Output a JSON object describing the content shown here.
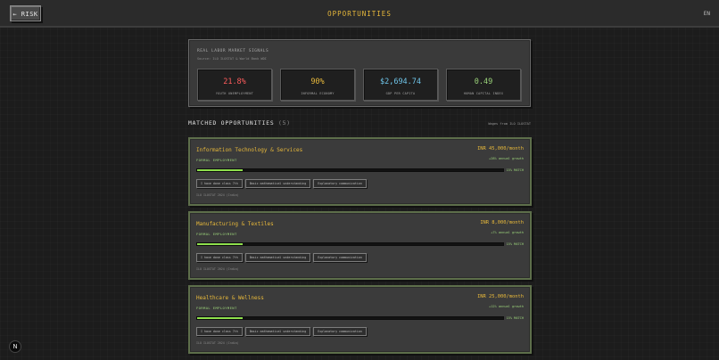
{
  "header": {
    "back_label": "← RISK",
    "title": "OPPORTUNITIES",
    "lang": "EN"
  },
  "signals": {
    "title": "REAL LABOR MARKET SIGNALS",
    "source": "Source: ILO ILOSTAT & World Bank WDI",
    "stats": [
      {
        "value": "21.8%",
        "label": "YOUTH UNEMPLOYMENT",
        "color": "#ff5c5c"
      },
      {
        "value": "90%",
        "label": "INFORMAL ECONOMY",
        "color": "#e8b93b"
      },
      {
        "value": "$2,694.74",
        "label": "GDP PER CAPITA",
        "color": "#6fc4e8"
      },
      {
        "value": "0.49",
        "label": "HUMAN CAPITAL INDEX",
        "color": "#9bd37a"
      }
    ]
  },
  "matched": {
    "title": "MATCHED OPPORTUNITIES",
    "count": "(5)",
    "source": "Wages from ILO ILOSTAT"
  },
  "cards": [
    {
      "title": "Information Technology & Services",
      "type": "FORMAL EMPLOYMENT",
      "wage": "INR 45,000/month",
      "growth": "+28% annual growth",
      "match": "15% MATCH",
      "match_fraction": 0.15,
      "skills": [
        "I have done class 7th",
        "Basic mathematical understanding",
        "Explanatory communication"
      ],
      "note": "ILO ILOSTAT 2024 (India)"
    },
    {
      "title": "Manufacturing & Textiles",
      "type": "FORMAL EMPLOYMENT",
      "wage": "INR 8,000/month",
      "growth": "+7% annual growth",
      "match": "15% MATCH",
      "match_fraction": 0.15,
      "skills": [
        "I have done class 7th",
        "Basic mathematical understanding",
        "Explanatory communication"
      ],
      "note": "ILO ILOSTAT 2024 (India)"
    },
    {
      "title": "Healthcare & Wellness",
      "type": "FORMAL EMPLOYMENT",
      "wage": "INR 25,000/month",
      "growth": "+12% annual growth",
      "match": "15% MATCH",
      "match_fraction": 0.15,
      "skills": [
        "I have done class 7th",
        "Basic mathematical understanding",
        "Explanatory communication"
      ],
      "note": "ILO ILOSTAT 2024 (India)"
    }
  ],
  "badge": {
    "logo": "N"
  }
}
